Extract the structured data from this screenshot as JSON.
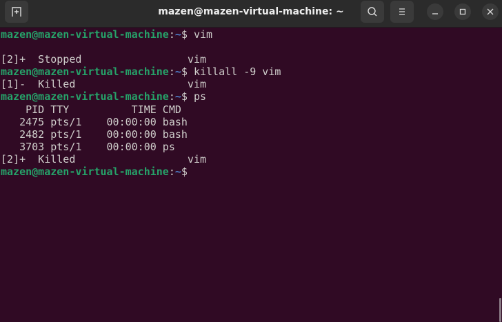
{
  "window": {
    "title": "mazen@mazen-virtual-machine: ~"
  },
  "header": {
    "new_tab_icon": "new-tab-icon",
    "search_icon": "search-icon",
    "menu_icon": "hamburger-menu-icon",
    "minimize": "_",
    "maximize": "□",
    "close": "×"
  },
  "prompt": {
    "user_host": "mazen@mazen-virtual-machine",
    "colon": ":",
    "path": "~",
    "dollar": "$ "
  },
  "lines": [
    {
      "type": "prompt",
      "cmd": "vim"
    },
    {
      "type": "out",
      "text": ""
    },
    {
      "type": "out",
      "text": "[2]+  Stopped                 vim"
    },
    {
      "type": "prompt",
      "cmd": "killall -9 vim"
    },
    {
      "type": "out",
      "text": "[1]-  Killed                  vim"
    },
    {
      "type": "prompt",
      "cmd": "ps"
    },
    {
      "type": "out",
      "text": "    PID TTY          TIME CMD"
    },
    {
      "type": "out",
      "text": "   2475 pts/1    00:00:00 bash"
    },
    {
      "type": "out",
      "text": "   2482 pts/1    00:00:00 bash"
    },
    {
      "type": "out",
      "text": "   3703 pts/1    00:00:00 ps"
    },
    {
      "type": "out",
      "text": "[2]+  Killed                  vim"
    },
    {
      "type": "prompt",
      "cmd": ""
    }
  ],
  "colors": {
    "background": "#300a24",
    "user": "#26a269",
    "path": "#4e7fc9"
  }
}
